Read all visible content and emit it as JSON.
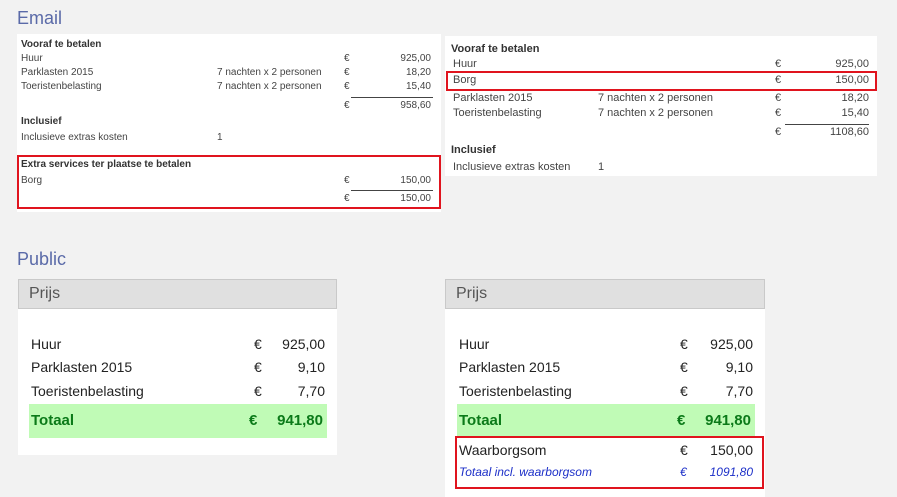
{
  "email": {
    "title": "Email",
    "left": {
      "prepay_header": "Vooraf te betalen",
      "rows": [
        {
          "label": "Huur",
          "detail": "",
          "currency": "€",
          "amount": "925,00"
        },
        {
          "label": "Parklasten 2015",
          "detail": "7 nachten x 2 personen",
          "currency": "€",
          "amount": "18,20"
        },
        {
          "label": "Toeristenbelasting",
          "detail": "7 nachten x 2 personen",
          "currency": "€",
          "amount": "15,40"
        }
      ],
      "subtotal": {
        "currency": "€",
        "amount": "958,60"
      },
      "incl_header": "Inclusief",
      "incl_row": {
        "label": "Inclusieve extras kosten",
        "value": "1"
      },
      "extra_header": "Extra services ter plaatse te betalen",
      "extra_row": {
        "label": "Borg",
        "currency": "€",
        "amount": "150,00"
      },
      "extra_total": {
        "currency": "€",
        "amount": "150,00"
      }
    },
    "right": {
      "prepay_header": "Vooraf te betalen",
      "rows": [
        {
          "label": "Huur",
          "detail": "",
          "currency": "€",
          "amount": "925,00"
        },
        {
          "label": "Borg",
          "detail": "",
          "currency": "€",
          "amount": "150,00"
        },
        {
          "label": "Parklasten 2015",
          "detail": "7 nachten x 2 personen",
          "currency": "€",
          "amount": "18,20"
        },
        {
          "label": "Toeristenbelasting",
          "detail": "7 nachten x 2 personen",
          "currency": "€",
          "amount": "15,40"
        }
      ],
      "subtotal": {
        "currency": "€",
        "amount": "1108,60"
      },
      "incl_header": "Inclusief",
      "incl_row": {
        "label": "Inclusieve extras kosten",
        "value": "1"
      }
    }
  },
  "public": {
    "title": "Public",
    "left": {
      "header": "Prijs",
      "rows": [
        {
          "label": "Huur",
          "currency": "€",
          "amount": "925,00"
        },
        {
          "label": "Parklasten 2015",
          "currency": "€",
          "amount": "9,10"
        },
        {
          "label": "Toeristenbelasting",
          "currency": "€",
          "amount": "7,70"
        }
      ],
      "total": {
        "label": "Totaal",
        "currency": "€",
        "amount": "941,80"
      }
    },
    "right": {
      "header": "Prijs",
      "rows": [
        {
          "label": "Huur",
          "currency": "€",
          "amount": "925,00"
        },
        {
          "label": "Parklasten 2015",
          "currency": "€",
          "amount": "9,10"
        },
        {
          "label": "Toeristenbelasting",
          "currency": "€",
          "amount": "7,70"
        }
      ],
      "total": {
        "label": "Totaal",
        "currency": "€",
        "amount": "941,80"
      },
      "deposit": {
        "label": "Waarborgsom",
        "currency": "€",
        "amount": "150,00"
      },
      "grand_total": {
        "label": "Totaal incl. waarborgsom",
        "currency": "€",
        "amount": "1091,80"
      }
    }
  }
}
